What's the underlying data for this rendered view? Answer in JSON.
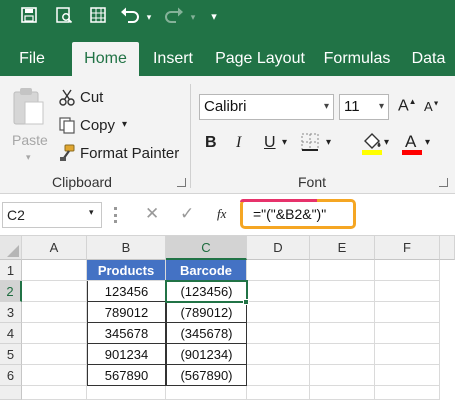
{
  "colors": {
    "excel_green": "#217346",
    "header_blue": "#4472c4",
    "highlight_pink": "#e7326b",
    "highlight_orange": "#f5a623"
  },
  "quick_access": {
    "icons": [
      "save-icon",
      "print-preview-icon",
      "table-grid-icon",
      "undo-icon",
      "redo-icon",
      "customize-icon"
    ]
  },
  "tabs": [
    "File",
    "Home",
    "Insert",
    "Page Layout",
    "Formulas",
    "Data"
  ],
  "clipboard": {
    "paste": "Paste",
    "cut": "Cut",
    "copy": "Copy",
    "format_painter": "Format Painter",
    "group_label": "Clipboard"
  },
  "font": {
    "name": "Calibri",
    "size": "11",
    "bold": "B",
    "italic": "I",
    "underline": "U",
    "group_label": "Font"
  },
  "formula_bar": {
    "name_box": "C2",
    "fx": "fx",
    "formula": "=\"(\"&B2&\")\""
  },
  "grid": {
    "columns": [
      "A",
      "B",
      "C",
      "D",
      "E",
      "F"
    ],
    "rows": [
      "1",
      "2",
      "3",
      "4",
      "5",
      "6"
    ],
    "headers": [
      "Products",
      "Barcode"
    ],
    "data": [
      [
        "123456",
        "(123456)"
      ],
      [
        "789012",
        "(789012)"
      ],
      [
        "345678",
        "(345678)"
      ],
      [
        "901234",
        "(901234)"
      ],
      [
        "567890",
        "(567890)"
      ]
    ],
    "active_cell": "C2"
  }
}
